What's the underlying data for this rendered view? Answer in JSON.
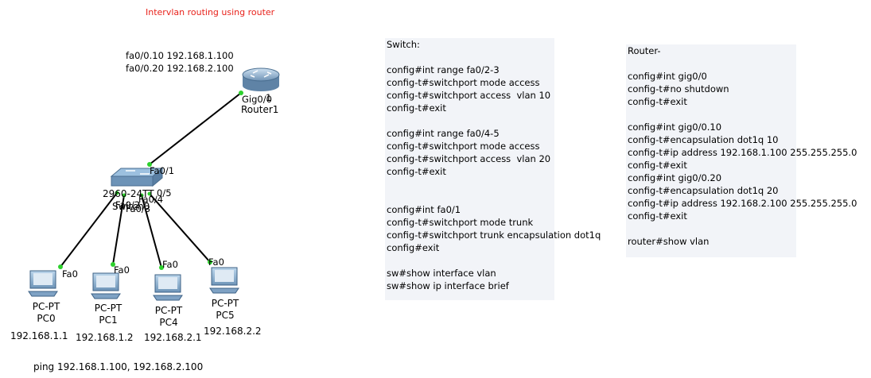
{
  "title": "Intervlan routing using router",
  "router_notes": [
    "fa0/0.10 192.168.1.100",
    "fa0/0.20 192.168.2.100"
  ],
  "router": {
    "name": "Router1",
    "port": "Gig0/0",
    "port_overlap": "1"
  },
  "switch": {
    "model": "2960-24TT",
    "name": "Switch0",
    "uplink_port": "Fa0/1",
    "ports": [
      "Fa0/2",
      "Fa0/3",
      "Fa0/4",
      "Fa0/5"
    ],
    "overlap_label": "0/5"
  },
  "pcs": [
    {
      "type": "PC-PT",
      "name": "PC0",
      "ip": "192.168.1.1",
      "port": "Fa0"
    },
    {
      "type": "PC-PT",
      "name": "PC1",
      "ip": "192.168.1.2",
      "port": "Fa0"
    },
    {
      "type": "PC-PT",
      "name": "PC4",
      "ip": "192.168.2.1",
      "port": "Fa0"
    },
    {
      "type": "PC-PT",
      "name": "PC5",
      "ip": "192.168.2.2",
      "port": "Fa0"
    }
  ],
  "ping_note": "ping 192.168.1.100, 192.168.2.100",
  "switch_note": {
    "lines": [
      "Switch:",
      "",
      "config#int range fa0/2-3",
      "config-t#switchport mode access",
      "config-t#switchport access  vlan 10",
      "config-t#exit",
      "",
      "config#int range fa0/4-5",
      "config-t#switchport mode access",
      "config-t#switchport access  vlan 20",
      "config-t#exit",
      "",
      "",
      "config#int fa0/1",
      "config-t#switchport mode trunk",
      "config-t#switchport trunk encapsulation dot1q",
      "config#exit",
      "",
      "sw#show interface vlan",
      "sw#show ip interface brief"
    ]
  },
  "router_note": {
    "lines": [
      "Router-",
      "",
      "config#int gig0/0",
      "config-t#no shutdown",
      "config-t#exit",
      "",
      "config#int gig0/0.10",
      "config-t#encapsulation dot1q 10",
      "config-t#ip address 192.168.1.100 255.255.255.0",
      "config-t#exit",
      "config#int gig0/0.20",
      "config-t#encapsulation dot1q 20",
      "config-t#ip address 192.168.2.100 255.255.255.0",
      "config-t#exit",
      "",
      "router#show vlan"
    ]
  },
  "colors": {
    "title": "#e8231c",
    "link": "#000000",
    "link_up": "#2dd12d",
    "note_bg": "#f2f4f8"
  }
}
